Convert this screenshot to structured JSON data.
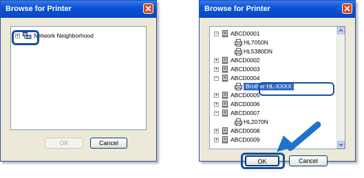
{
  "left_dialog": {
    "title": "Browse for Printer",
    "tree": {
      "expander": "+",
      "root_label": "Network Neighborhood",
      "root_icon": "network-neighborhood-icon"
    },
    "ok_label": "OK",
    "cancel_label": "Cancel"
  },
  "right_dialog": {
    "title": "Browse for Printer",
    "tree_items": [
      {
        "label": "ABCD0001",
        "type": "computer",
        "expander": "−"
      },
      {
        "label": "HL7050N",
        "type": "printer"
      },
      {
        "label": "HL5380DN",
        "type": "printer"
      },
      {
        "label": "ABCD0002",
        "type": "computer",
        "expander": "+"
      },
      {
        "label": "ABCD0003",
        "type": "computer",
        "expander": "+"
      },
      {
        "label": "ABCD0004",
        "type": "computer",
        "expander": "−"
      },
      {
        "label": "Brother HL-XXXX",
        "type": "printer",
        "selected": true
      },
      {
        "label": "ABCD0005",
        "type": "computer",
        "expander": "+"
      },
      {
        "label": "ABCD0006",
        "type": "computer",
        "expander": "+"
      },
      {
        "label": "ABCD0007",
        "type": "computer",
        "expander": "−"
      },
      {
        "label": "HL2070N",
        "type": "printer"
      },
      {
        "label": "ABCD0008",
        "type": "computer",
        "expander": "+"
      },
      {
        "label": "ABCD0009",
        "type": "computer",
        "expander": "+"
      }
    ],
    "ok_label": "OK",
    "cancel_label": "Cancel"
  },
  "colors": {
    "title_bar": "#0a52d8",
    "selection": "#316ac5",
    "callout": "#154e9c",
    "arrow": "#1f73c8"
  }
}
